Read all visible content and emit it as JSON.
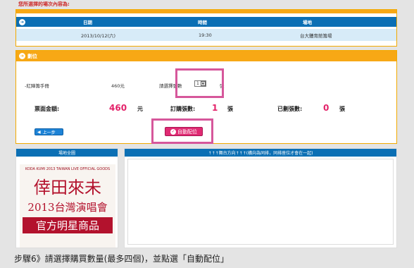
{
  "top_heading": "您所選擇的場次內容為:",
  "event_table": {
    "headers": [
      "日期",
      "時間",
      "場地"
    ],
    "row": {
      "date": "2013/10/12(六)",
      "time": "19:30",
      "venue": "台大體育館籌場"
    }
  },
  "seat_panel": {
    "title": "劃位",
    "ticket": {
      "name": "-紅陣籌手冊",
      "price": "460元",
      "select_label": "請選擇張數",
      "quantity": "1",
      "unit": "張"
    },
    "summary": {
      "face_value_label": "票面金額:",
      "face_value": "460",
      "face_value_unit": "元",
      "ordered_label": "訂購張數:",
      "ordered": "1",
      "ordered_unit": "張",
      "assigned_label": "已劃張數:",
      "assigned": "0",
      "assigned_unit": "張"
    },
    "back_button": "上一步",
    "auto_button": "自動配位"
  },
  "map_panel": {
    "title": "場地全圖",
    "stage_text": "↑↑↑舞台方向↑↑↑(橫向為同排，同排座位才會在一起)",
    "poster": {
      "brand": "KODA KUMI 2013 TAIWAN LIVE OFFICIAL GOODS",
      "line1": "倖田來未",
      "line2": "2013台灣演唱會",
      "line3": "官方明星商品"
    }
  },
  "caption": "步驟6》請選擇購買數量(最多四個)，並點選「自動配位」",
  "colors": {
    "accent_orange": "#f7a815",
    "header_blue": "#0b6fb4",
    "highlight_pink": "#d6579b",
    "number_red": "#e32269"
  }
}
